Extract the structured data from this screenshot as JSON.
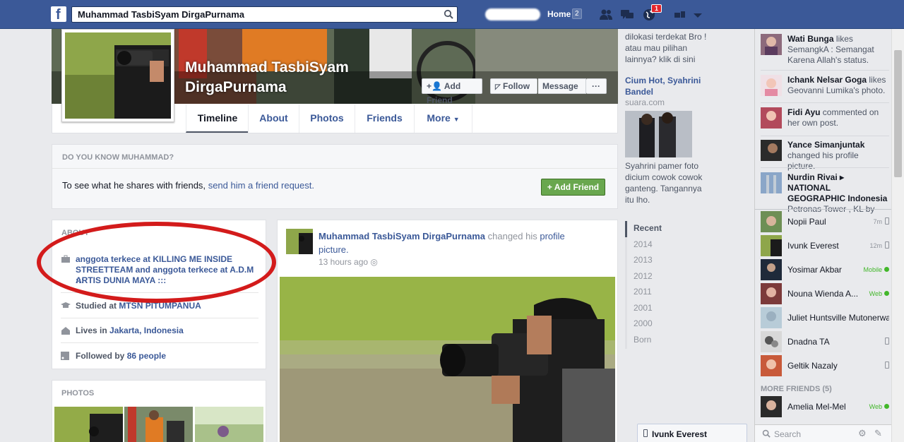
{
  "topbar": {
    "search_value": "Muhammad TasbiSyam DirgaPurnama",
    "home_label": "Home",
    "home_count": "2",
    "notifications_count": "1",
    "brand": "f"
  },
  "profile": {
    "name_line1": "Muhammad TasbiSyam",
    "name_line2": "DirgaPurnama",
    "buttons": {
      "add_friend": "Add Friend",
      "follow": "Follow",
      "message": "Message",
      "more": "···"
    },
    "tabs": [
      "Timeline",
      "About",
      "Photos",
      "Friends",
      "More"
    ]
  },
  "know": {
    "heading": "DO YOU KNOW MUHAMMAD?",
    "text": "To see what he shares with friends,",
    "link": "send him a friend request.",
    "button": "Add Friend"
  },
  "about": {
    "heading": "ABOUT",
    "work_1": "anggota terkece at KILLING ME INSIDE",
    "work_2": "STREETTEAM and anggota terkece at A.D.M :::",
    "work_3": "ARTIS DUNIA MAYA :::",
    "studied_prefix": "Studied at",
    "studied_school": "MTSN PITUMPANUA",
    "lives_prefix": "Lives in",
    "lives_place": "Jakarta, Indonesia",
    "followed_prefix": "Followed by",
    "followed_count": "86 people"
  },
  "photos": {
    "heading": "PHOTOS"
  },
  "post": {
    "author": "Muhammad TasbiSyam DirgaPurnama",
    "action": "changed his",
    "object": "profile",
    "object_2": "picture.",
    "time": "13 hours ago"
  },
  "ads": {
    "ad1_line1": "dilokasi terdekat Bro !",
    "ad1_line2": "atau mau pilihan",
    "ad1_line3": "lainnya? klik di sini",
    "ad2_title1": "Cium Hot, Syahrini",
    "ad2_title2": "Bandel",
    "ad2_source": "suara.com",
    "ad2_line1": "Syahrini pamer foto",
    "ad2_line2": "dicium cowok cowok",
    "ad2_line3": "ganteng. Tangannya",
    "ad2_line4": "itu lho."
  },
  "years": [
    "Recent",
    "2014",
    "2013",
    "2012",
    "2011",
    "2001",
    "2000",
    "Born"
  ],
  "ticker": [
    {
      "name": "Wati Bunga",
      "action": "likes",
      "line2": "SemangkA : Semangat",
      "line3": "Karena Allah's status."
    },
    {
      "name": "Ichank Nelsar Goga",
      "action": "likes",
      "line2": "Geovanni Lumika's photo.",
      "line3": ""
    },
    {
      "name": "Fidi Ayu",
      "action": "commented on",
      "line2": "her own post.",
      "line3": ""
    },
    {
      "name": "Yance Simanjuntak",
      "action": "",
      "line2": "changed his profile picture.",
      "line3": ""
    },
    {
      "name": "Nurdin Rivai",
      "action": "▸ NATIONAL",
      "line2": "GEOGRAPHIC Indonesia",
      "line3": "Petronas Tower , KL by"
    }
  ],
  "chat": [
    {
      "name": "Nopii Paul",
      "status": "7m",
      "kind": "mobile"
    },
    {
      "name": "Ivunk Everest",
      "status": "12m",
      "kind": "mobile"
    },
    {
      "name": "Yosimar Akbar",
      "status": "Mobile",
      "kind": "online"
    },
    {
      "name": "Nouna Wienda A...",
      "status": "Web",
      "kind": "online"
    },
    {
      "name": "Juliet Huntsville Mutonerwa",
      "status": "",
      "kind": "none"
    },
    {
      "name": "Dnadna TA",
      "status": "",
      "kind": "mobile"
    },
    {
      "name": "Geltik Nazaly",
      "status": "",
      "kind": "mobile"
    }
  ],
  "more_friends_label": "MORE FRIENDS (5)",
  "more_friend": {
    "name": "Amelia Mel-Mel",
    "status": "Web"
  },
  "chat_search_placeholder": "Search",
  "chat_tab_name": "Ivunk Everest"
}
